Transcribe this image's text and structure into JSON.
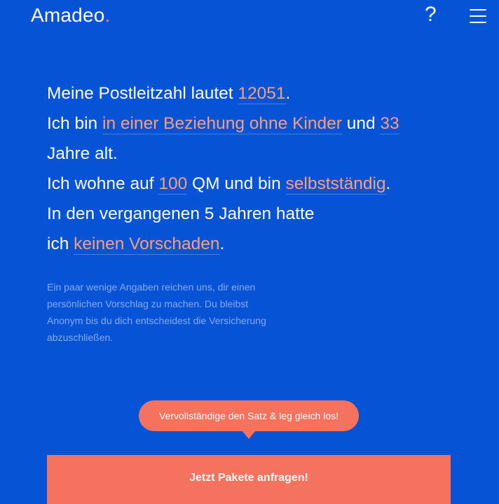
{
  "header": {
    "logo_text": "Amadeo",
    "logo_dot": ".",
    "help_label": "?",
    "menu_icon": "hamburger-menu-icon"
  },
  "sentence": {
    "line1": {
      "prefix": "Meine Postleitzahl lautet ",
      "postal_code": "12051",
      "suffix": "."
    },
    "line2": {
      "prefix": "Ich bin ",
      "relationship": "in einer Beziehung ohne Kinder",
      "middle": " und ",
      "age": "33"
    },
    "line3": {
      "text": "Jahre alt."
    },
    "line4": {
      "prefix": "Ich wohne auf ",
      "size": "100",
      "middle": " QM und bin ",
      "occupation": "selbstständig",
      "suffix": "."
    },
    "line5": {
      "text": "In den vergangenen 5 Jahren hatte"
    },
    "line6": {
      "prefix": "ich ",
      "damages": "keinen Vorschaden",
      "suffix": "."
    }
  },
  "note": "Ein paar wenige Angaben reichen uns, dir einen persönlichen Vorschlag zu machen. Du bleibst Anonym bis du dich entscheidest die Versicherung abzuschließen.",
  "tooltip": "Vervollständige den Satz & leg gleich los!",
  "cta_label": "Jetzt Pakete anfragen!",
  "colors": {
    "background": "#0753d6",
    "accent": "#f4725e",
    "value_text": "#f9a07c",
    "note_text": "#86a9ef"
  }
}
